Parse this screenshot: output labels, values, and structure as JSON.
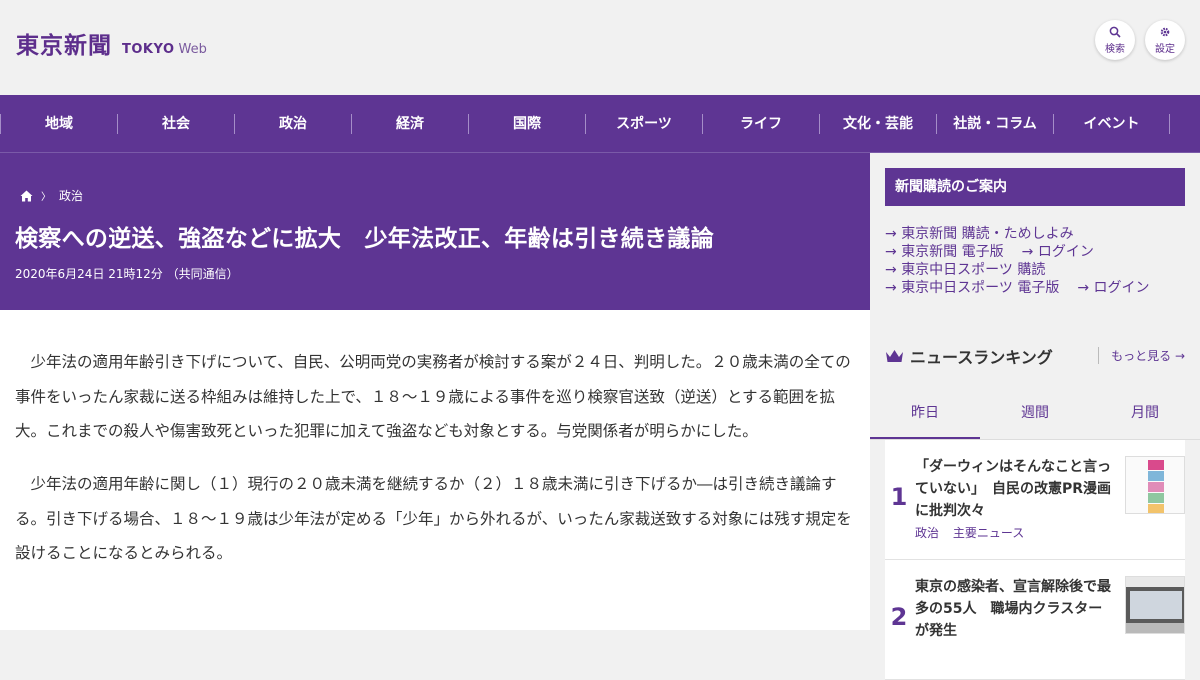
{
  "header": {
    "logo_kanji": "東京新聞",
    "logo_latin": "TOKYO",
    "logo_web": "Web",
    "search_label": "検索",
    "settings_label": "設定"
  },
  "nav": [
    "地域",
    "社会",
    "政治",
    "経済",
    "国際",
    "スポーツ",
    "ライフ",
    "文化・芸能",
    "社説・コラム",
    "イベント"
  ],
  "breadcrumb": {
    "section": "政治"
  },
  "article": {
    "title": "検察への逆送、強盗などに拡大　少年法改正、年齢は引き続き議論",
    "date": "2020年6月24日 21時12分 （共同通信）",
    "paragraphs": [
      "　少年法の適用年齢引き下げについて、自民、公明両党の実務者が検討する案が２４日、判明した。２０歳未満の全ての事件をいったん家裁に送る枠組みは維持した上で、１８～１９歳による事件を巡り検察官送致（逆送）とする範囲を拡大。これまでの殺人や傷害致死といった犯罪に加えて強盗なども対象とする。与党関係者が明らかにした。",
      "　少年法の適用年齢に関し（１）現行の２０歳未満を継続するか（２）１８歳未満に引き下げるか―は引き続き議論する。引き下げる場合、１８～１９歳は少年法が定める「少年」から外れるが、いったん家裁送致する対象には残す規定を設けることになるとみられる。"
    ]
  },
  "sidebar": {
    "subscribe_title": "新聞購読のご案内",
    "links": {
      "l1": "東京新聞 購読・ためしよみ",
      "l2": "東京新聞 電子版",
      "l3": "ログイン",
      "l4": "東京中日スポーツ 購読",
      "l5": "東京中日スポーツ 電子版",
      "l6": "ログイン"
    },
    "ranking_title": "ニュースランキング",
    "more": "もっと見る",
    "tabs": [
      "昨日",
      "週間",
      "月間"
    ],
    "items": [
      {
        "num": "1",
        "text": "「ダーウィンはそんなこと言っていない」　自民の改憲PR漫画に批判次々",
        "tags": [
          "政治",
          "主要ニュース"
        ]
      },
      {
        "num": "2",
        "text": "東京の感染者、宣言解除後で最多の55人　職場内クラスターが発生",
        "tags": []
      }
    ]
  },
  "colors": {
    "brand": "#5e3593",
    "background": "#f1f1f1"
  }
}
